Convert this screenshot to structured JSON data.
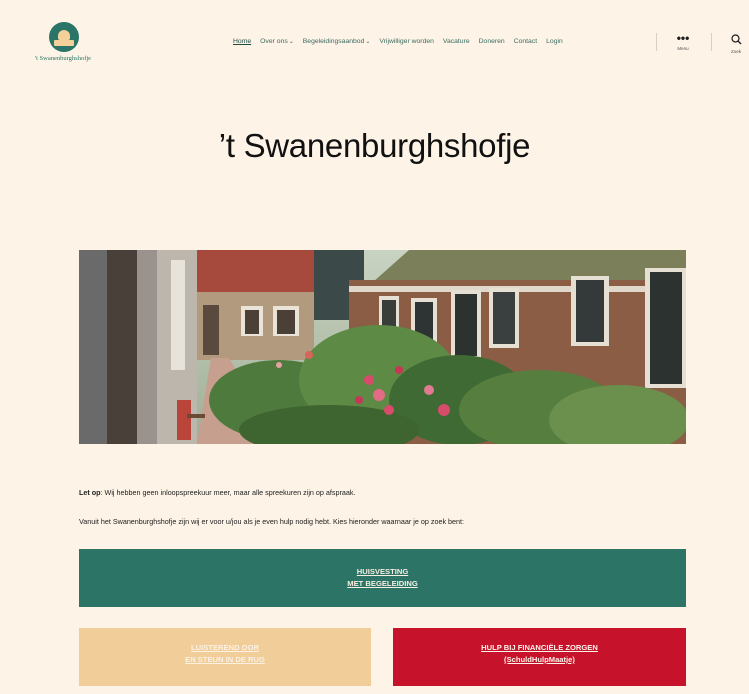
{
  "site": {
    "logo_text": "'t Swanenburghshofje",
    "title": "’t Swanenburghshofje"
  },
  "nav": {
    "items": [
      {
        "label": "Home",
        "active": true,
        "has_dropdown": false
      },
      {
        "label": "Over ons",
        "active": false,
        "has_dropdown": true
      },
      {
        "label": "Begeleidingsaanbod",
        "active": false,
        "has_dropdown": true
      },
      {
        "label": "Vrijwilliger worden",
        "active": false,
        "has_dropdown": false
      },
      {
        "label": "Vacature",
        "active": false,
        "has_dropdown": false
      },
      {
        "label": "Doneren",
        "active": false,
        "has_dropdown": false
      },
      {
        "label": "Contact",
        "active": false,
        "has_dropdown": false
      },
      {
        "label": "Login",
        "active": false,
        "has_dropdown": false
      }
    ],
    "menu_label": "Menu",
    "search_label": "Zoek",
    "menu_icon": "ellipsis-icon",
    "search_icon": "search-icon"
  },
  "content": {
    "note_bold": "Let op",
    "note_text": ": Wij hebben geen inloopspreekuur meer, maar alle spreekuren zijn op afspraak.",
    "intro": "Vanuit het Swanenburghshofje zijn wij er voor u/jou als je even hulp nodig hebt. Kies hieronder waarnaar je op zoek bent:"
  },
  "cta": {
    "housing_line1": "HUISVESTING",
    "housing_line2": "MET BEGELEIDING",
    "listen_line1": "LUISTEREND OOR",
    "listen_line2": "EN STEUN IN DE RUG",
    "finance_line1": "HULP BIJ FINANCIËLE ZORGEN",
    "finance_line2": "(SchuldHulpMaatje)"
  },
  "colors": {
    "background": "#fdf3e6",
    "green": "#2b7466",
    "beige": "#f1cd9a",
    "red": "#c6122a"
  }
}
